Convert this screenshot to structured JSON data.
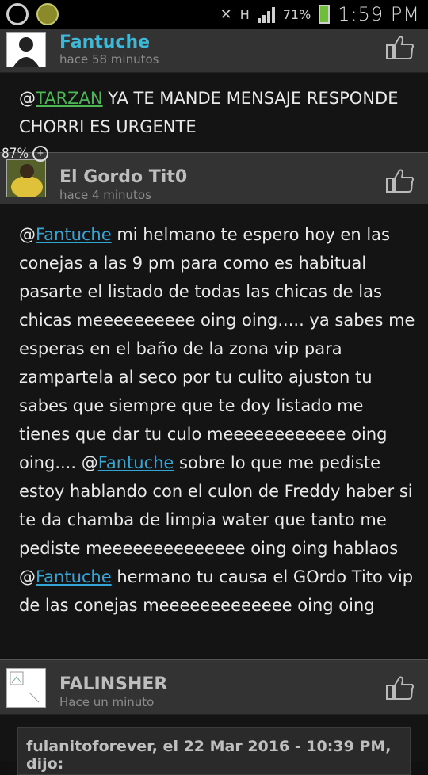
{
  "status_bar": {
    "network_label": "H",
    "battery_percent": "71%",
    "time": "1:59 PM"
  },
  "zoom_badge": "87%",
  "posts": [
    {
      "user": "Fantuche",
      "user_color": "#3fb8d8",
      "time": "hace 58 minutos",
      "mention": "@TARZAN",
      "text_after_mention": " YA TE MANDE MENSAJE RESPONDE CHORRI ES URGENTE"
    },
    {
      "user": "El Gordo Tit0",
      "user_color": "#bdbdbd",
      "time": "hace 4 minutos",
      "segments": [
        "@",
        "Fantuche",
        " mi helmano te espero hoy en las conejas a las 9 pm para como es habitual pasarte el listado de todas las chicas de las chicas meeeeeeeeee oing oing..... ya sabes me esperas en el baño de la zona vip para zampartela al seco por tu culito ajuston tu sabes que siempre que te doy listado me tienes que dar tu culo meeeeeeeeeeee oing oing.... @",
        "Fantuche",
        " sobre lo que me pediste estoy hablando con el culon de Freddy haber si te da chamba de limpia water que tanto me pediste meeeeeeeeeeeeee oing oing hablaos @",
        "Fantuche",
        " hermano tu causa el GOrdo Tito vip de las conejas meeeeeeeeeeeee oing oing"
      ]
    },
    {
      "user": "FALINSHER",
      "user_color": "#bdbdbd",
      "time": "Hace un minuto"
    }
  ],
  "quote_header": "fulanitoforever, el 22 Mar 2016 - 10:39 PM, dijo:"
}
